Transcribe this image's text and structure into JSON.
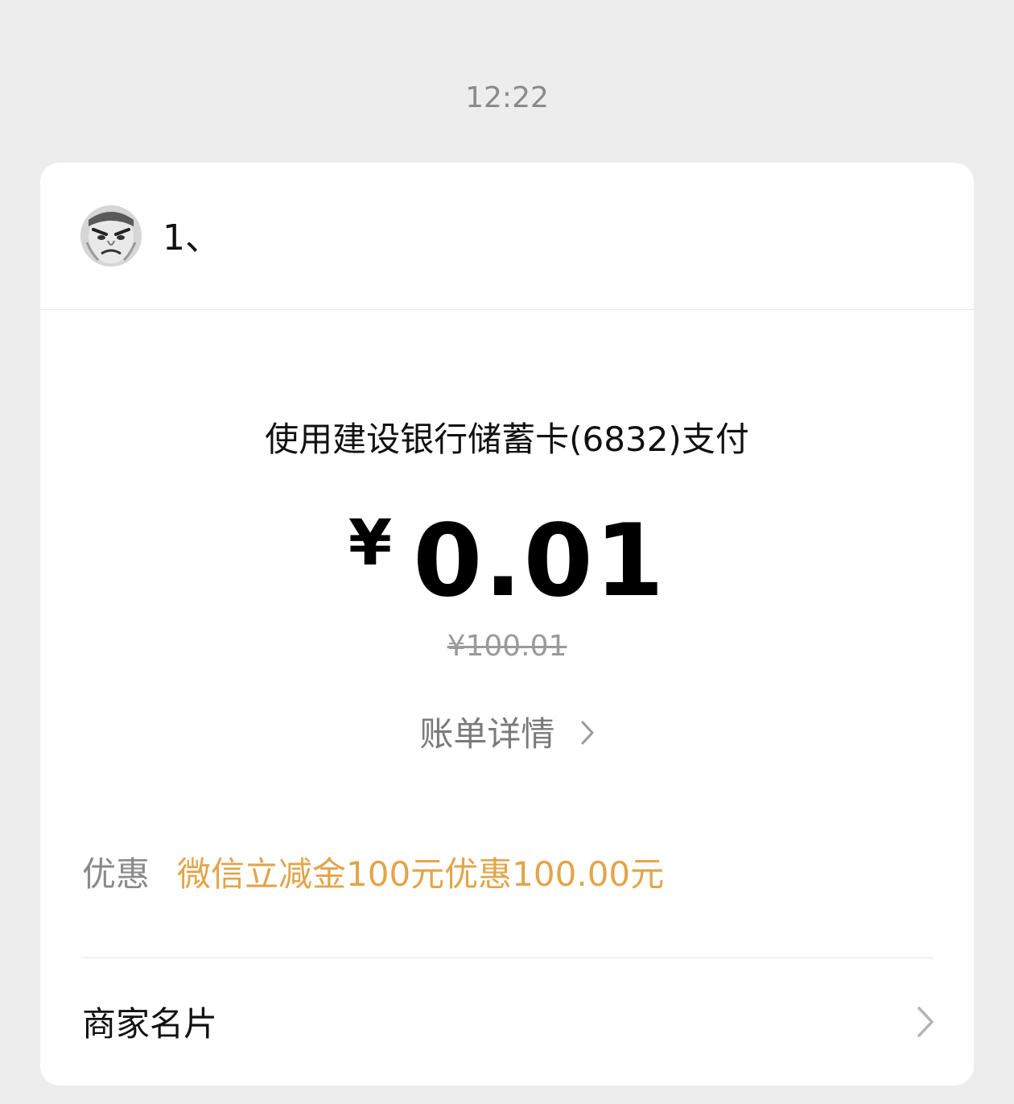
{
  "status": {
    "time": "12:22"
  },
  "merchant": {
    "name": "1、",
    "avatar_icon": "face-avatar-icon"
  },
  "payment": {
    "method_text": "使用建设银行储蓄卡(6832)支付",
    "currency_symbol": "¥",
    "amount": "0.01",
    "original_price": "¥100.01",
    "bill_details_label": "账单详情"
  },
  "discount": {
    "label": "优惠",
    "value": "微信立减金100元优惠100.00元"
  },
  "merchant_card": {
    "label": "商家名片"
  },
  "colors": {
    "background": "#ededed",
    "card": "#ffffff",
    "discount_accent": "#e2a54a",
    "muted_text": "#8a8a8a"
  }
}
